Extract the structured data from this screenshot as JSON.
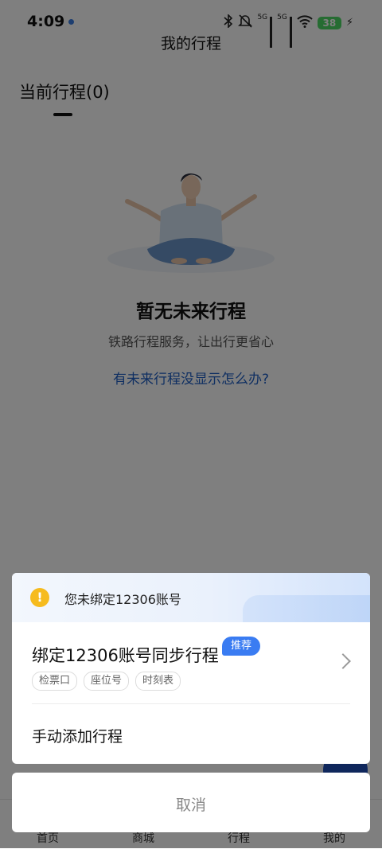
{
  "status_bar": {
    "time": "4:09",
    "net1": "5G",
    "net2": "5G",
    "battery": "38"
  },
  "header": {
    "title": "我的行程"
  },
  "tabs": {
    "current": "当前行程(0)"
  },
  "empty_state": {
    "title": "暂无未来行程",
    "subtitle": "铁路行程服务，让出行更省心",
    "help_link": "有未来行程没显示怎么办?"
  },
  "bottom_nav": {
    "items": [
      {
        "label": "首页"
      },
      {
        "label": "商城"
      },
      {
        "label": "行程"
      },
      {
        "label": "我的"
      }
    ]
  },
  "sheet": {
    "notice": "您未绑定12306账号",
    "bind_option": {
      "title": "绑定12306账号同步行程",
      "badge": "推荐",
      "tags": [
        "检票口",
        "座位号",
        "时刻表"
      ]
    },
    "manual_option": "手动添加行程",
    "cancel": "取消"
  },
  "colors": {
    "accent": "#3a7cf2",
    "link": "#1f5fc4",
    "warning": "#f6bb1e",
    "overlay": "rgba(0,0,0,0.5)"
  },
  "icons": [
    "bluetooth-icon",
    "mute-icon",
    "signal-icon",
    "wifi-icon",
    "battery-icon",
    "warning-icon",
    "chevron-right-icon"
  ]
}
